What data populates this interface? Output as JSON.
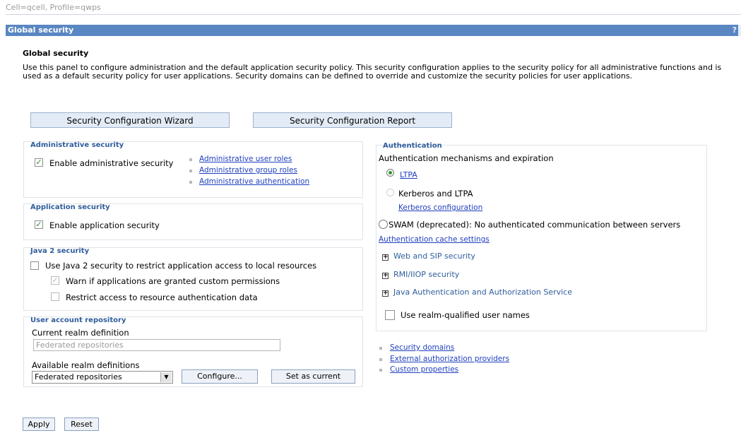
{
  "breadcrumb": "Cell=qcell, Profile=qwps",
  "titlebar": {
    "title": "Global security",
    "help": "?"
  },
  "page": {
    "heading": "Global security",
    "description": "Use this panel to configure administration and the default application security policy. This security configuration applies to the security policy for all administrative functions and is used as a default security policy for user applications. Security domains can be defined to override and customize the security policies for user applications."
  },
  "buttons": {
    "wizard": "Security Configuration Wizard",
    "report": "Security Configuration Report"
  },
  "admin_security": {
    "title": "Administrative security",
    "enable_label": "Enable administrative security",
    "enable_checked": true,
    "links": [
      "Administrative user roles",
      "Administrative group roles",
      "Administrative authentication"
    ]
  },
  "app_security": {
    "title": "Application security",
    "enable_label": "Enable application security",
    "enable_checked": true
  },
  "java2": {
    "title": "Java 2 security",
    "use_label": "Use Java 2 security to restrict application access to local resources",
    "warn_label": "Warn if applications are granted custom permissions",
    "restrict_label": "Restrict access to resource authentication data"
  },
  "user_repo": {
    "title": "User account repository",
    "current_label": "Current realm definition",
    "current_value": "Federated repositories",
    "available_label": "Available realm definitions",
    "available_value": "Federated repositories",
    "configure_btn": "Configure...",
    "set_current_btn": "Set as current"
  },
  "authentication": {
    "title": "Authentication",
    "mech_label": "Authentication mechanisms and expiration",
    "ltpa": "LTPA",
    "kerberos": "Kerberos and LTPA",
    "kerberos_config": "Kerberos configuration",
    "swam": "SWAM (deprecated): No authenticated communication between servers",
    "cache_settings": "Authentication cache settings",
    "expanders": [
      "Web and SIP security",
      "RMI/IIOP security",
      "Java Authentication and Authorization Service"
    ],
    "realm_qualified": "Use realm-qualified user names"
  },
  "bottom_links": [
    "Security domains",
    "External authorization providers",
    "Custom properties"
  ],
  "footer": {
    "apply": "Apply",
    "reset": "Reset"
  },
  "icons": {
    "check": "✓",
    "plus": "+",
    "select_arrow": "▼"
  }
}
